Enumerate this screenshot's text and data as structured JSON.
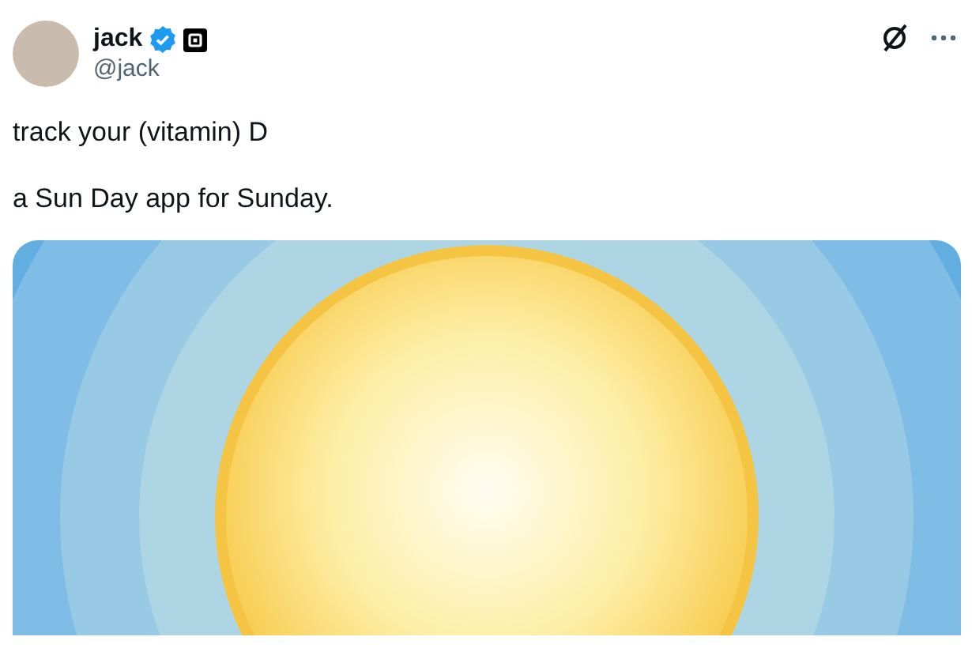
{
  "tweet": {
    "author": {
      "name": "jack",
      "handle": "@jack",
      "verified": true
    },
    "paragraphs": [
      "track your (vitamin) D",
      "a Sun Day app for Sunday."
    ]
  }
}
